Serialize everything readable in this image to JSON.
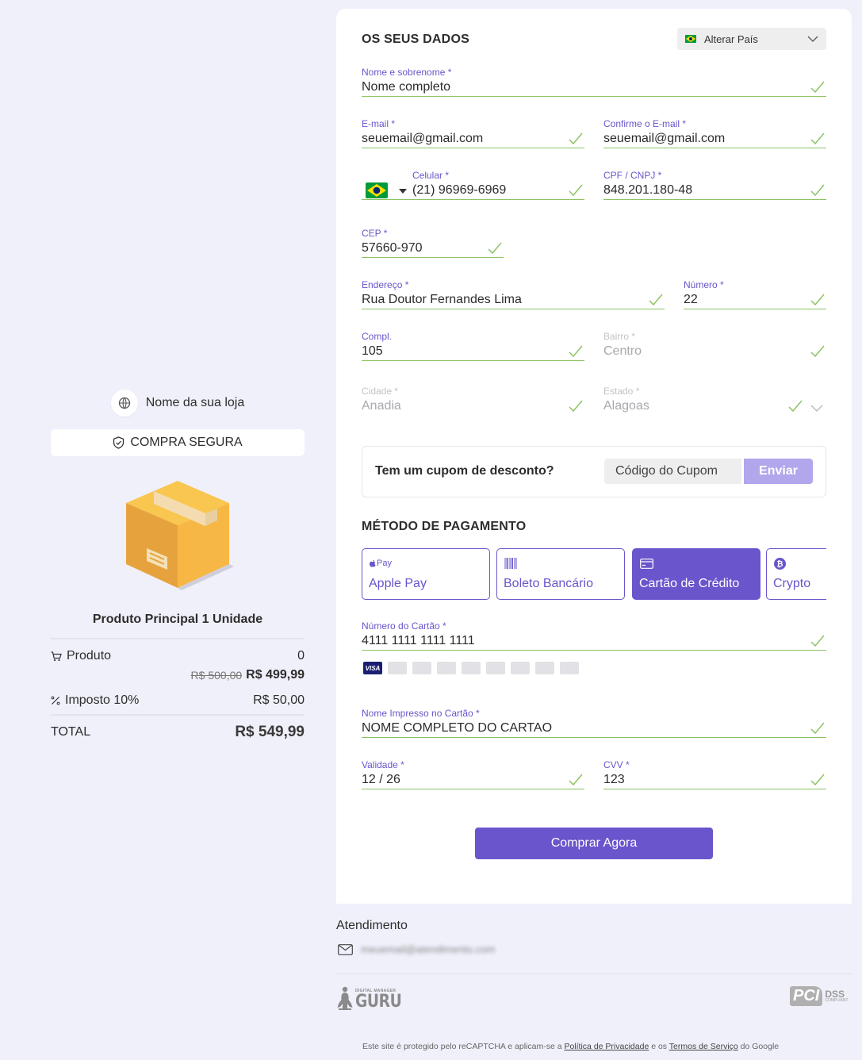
{
  "store": {
    "name": "Nome da sua loja",
    "secure_label": "COMPRA SEGURA"
  },
  "product": {
    "title": "Produto Principal 1 Unidade"
  },
  "summary": {
    "product_label": "Produto",
    "product_qty": "0",
    "old_price": "R$ 500,00",
    "new_price": "R$ 499,99",
    "tax_label": "Imposto 10%",
    "tax_value": "R$ 50,00",
    "total_label": "TOTAL",
    "total_value": "R$ 549,99"
  },
  "form": {
    "section_title": "OS SEUS DADOS",
    "country_button": "Alterar País",
    "name": {
      "label": "Nome e sobrenome *",
      "value": "Nome completo"
    },
    "email": {
      "label": "E-mail *",
      "value": "seuemail@gmail.com"
    },
    "email_confirm": {
      "label": "Confirme o E-mail *",
      "value": "seuemail@gmail.com"
    },
    "phone": {
      "label": "Celular *",
      "value": "(21) 96969-6969"
    },
    "cpf": {
      "label": "CPF / CNPJ *",
      "value": "848.201.180-48"
    },
    "cep": {
      "label": "CEP *",
      "value": "57660-970"
    },
    "address": {
      "label": "Endereço *",
      "value": "Rua Doutor Fernandes Lima"
    },
    "number": {
      "label": "Número *",
      "value": "22"
    },
    "compl": {
      "label": "Compl.",
      "value": "105"
    },
    "bairro": {
      "label": "Bairro *",
      "value": "Centro"
    },
    "cidade": {
      "label": "Cidade *",
      "value": "Anadia"
    },
    "estado": {
      "label": "Estado *",
      "value": "Alagoas"
    }
  },
  "coupon": {
    "question": "Tem um cupom de desconto?",
    "placeholder": "Código do Cupom",
    "button": "Enviar"
  },
  "payment": {
    "section_title": "MÉTODO DE PAGAMENTO",
    "applepay_icon_text": "Pay",
    "methods": [
      {
        "label": "Apple Pay",
        "icon": "apple-pay-icon",
        "active": false
      },
      {
        "label": "Boleto Bancário",
        "icon": "barcode-icon",
        "active": false
      },
      {
        "label": "Cartão de Crédito",
        "icon": "credit-card-icon",
        "active": true
      },
      {
        "label": "Crypto",
        "icon": "bitcoin-icon",
        "active": false
      }
    ],
    "card_number": {
      "label": "Número do Cartão *",
      "value": "4111 1111 1111 1111"
    },
    "card_name": {
      "label": "Nome Impresso no Cartão *",
      "value": "NOME COMPLETO DO CARTAO"
    },
    "validity": {
      "label": "Validade *",
      "value": "12 / 26"
    },
    "cvv": {
      "label": "CVV *",
      "value": "123"
    },
    "brands": [
      "visa-icon",
      "mastercard-icon",
      "amex-icon",
      "diners-icon",
      "discover-icon",
      "jcb-icon",
      "elo-icon",
      "hipercard-icon",
      "aura-icon"
    ],
    "visa_text": "VISA",
    "buy_button": "Comprar Agora"
  },
  "footer": {
    "support_title": "Atendimento",
    "support_email": "meuemail@atendimento.com",
    "guru_small": "DIGITAL MANAGER",
    "guru_big": "GURU",
    "pci_text": "PCI",
    "dss_text": "DSS",
    "dss_sub": "COMPLIANT",
    "legal_prefix": "Este site é protegido pelo reCAPTCHA e aplicam-se a",
    "privacy_link": "Política de Privacidade",
    "legal_mid": "e os",
    "terms_link": "Termos de Serviço",
    "legal_suffix": "do Google"
  },
  "colors": {
    "accent": "#6a55cc",
    "valid_line": "#8dc463",
    "background": "#f0f0fb"
  }
}
